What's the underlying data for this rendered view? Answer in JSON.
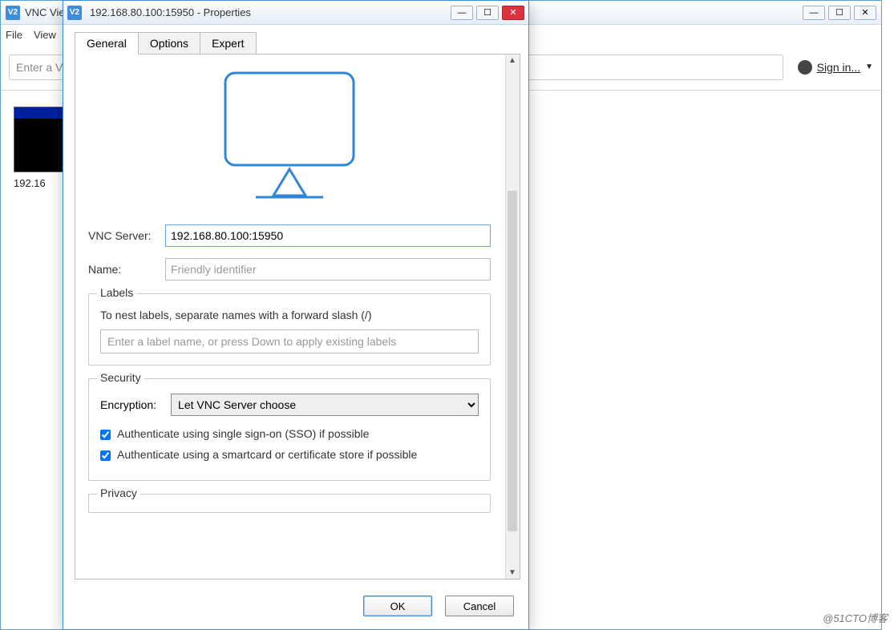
{
  "background": {
    "app_title": "VNC Vie",
    "menu": {
      "file": "File",
      "view": "View"
    },
    "address_placeholder": "Enter a VN",
    "signin": "Sign in...",
    "thumbnail_label": "192.16",
    "window_controls": {
      "min": "—",
      "max": "☐",
      "close": "✕"
    }
  },
  "dialog": {
    "title": "192.168.80.100:15950 - Properties",
    "tabs": {
      "general": "General",
      "options": "Options",
      "expert": "Expert"
    },
    "fields": {
      "vnc_server_label": "VNC Server:",
      "vnc_server_value": "192.168.80.100:15950",
      "name_label": "Name:",
      "name_placeholder": "Friendly identifier"
    },
    "labels_group": {
      "legend": "Labels",
      "hint": "To nest labels, separate names with a forward slash (/)",
      "input_placeholder": "Enter a label name, or press Down to apply existing labels"
    },
    "security_group": {
      "legend": "Security",
      "encryption_label": "Encryption:",
      "encryption_value": "Let VNC Server choose",
      "sso_label": "Authenticate using single sign-on (SSO) if possible",
      "smartcard_label": "Authenticate using a smartcard or certificate store if possible"
    },
    "privacy_group": {
      "legend": "Privacy"
    },
    "buttons": {
      "ok": "OK",
      "cancel": "Cancel"
    }
  },
  "watermark": "@51CTO博客"
}
